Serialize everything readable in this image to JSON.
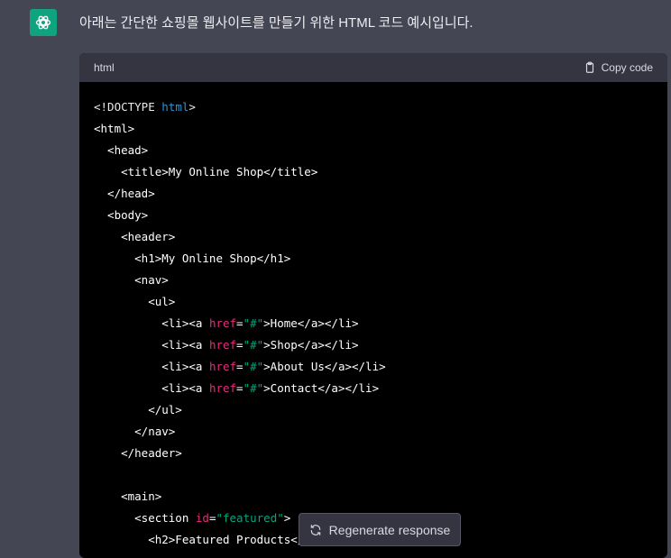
{
  "message": {
    "text": "아래는 간단한 쇼핑몰 웹사이트를 만들기 위한 HTML 코드 예시입니다."
  },
  "code": {
    "language": "html",
    "copy_label": "Copy code",
    "lines": [
      [
        [
          "doctype",
          "<!DOCTYPE "
        ],
        [
          "keyword",
          "html"
        ],
        [
          "doctype",
          ">"
        ]
      ],
      [
        [
          "tag",
          "<html>"
        ]
      ],
      [
        [
          "tag",
          "  <head>"
        ]
      ],
      [
        [
          "tag",
          "    <title>My Online Shop</title>"
        ]
      ],
      [
        [
          "tag",
          "  </head>"
        ]
      ],
      [
        [
          "tag",
          "  <body>"
        ]
      ],
      [
        [
          "tag",
          "    <header>"
        ]
      ],
      [
        [
          "tag",
          "      <h1>My Online Shop</h1>"
        ]
      ],
      [
        [
          "tag",
          "      <nav>"
        ]
      ],
      [
        [
          "tag",
          "        <ul>"
        ]
      ],
      [
        [
          "tag",
          "          <li><a "
        ],
        [
          "attr",
          "href"
        ],
        [
          "tag",
          "="
        ],
        [
          "str",
          "\"#\""
        ],
        [
          "tag",
          ">Home</a></li>"
        ]
      ],
      [
        [
          "tag",
          "          <li><a "
        ],
        [
          "attr",
          "href"
        ],
        [
          "tag",
          "="
        ],
        [
          "str",
          "\"#\""
        ],
        [
          "tag",
          ">Shop</a></li>"
        ]
      ],
      [
        [
          "tag",
          "          <li><a "
        ],
        [
          "attr",
          "href"
        ],
        [
          "tag",
          "="
        ],
        [
          "str",
          "\"#\""
        ],
        [
          "tag",
          ">About Us</a></li>"
        ]
      ],
      [
        [
          "tag",
          "          <li><a "
        ],
        [
          "attr",
          "href"
        ],
        [
          "tag",
          "="
        ],
        [
          "str",
          "\"#\""
        ],
        [
          "tag",
          ">Contact</a></li>"
        ]
      ],
      [
        [
          "tag",
          "        </ul>"
        ]
      ],
      [
        [
          "tag",
          "      </nav>"
        ]
      ],
      [
        [
          "tag",
          "    </header>"
        ]
      ],
      [
        [
          "tag",
          ""
        ]
      ],
      [
        [
          "tag",
          "    <main>"
        ]
      ],
      [
        [
          "tag",
          "      <section "
        ],
        [
          "attr",
          "id"
        ],
        [
          "tag",
          "="
        ],
        [
          "str",
          "\"featured\""
        ],
        [
          "tag",
          ">"
        ]
      ],
      [
        [
          "tag",
          "        <h2>Featured Products</h2>"
        ]
      ]
    ]
  },
  "regenerate": {
    "label": "Regenerate response"
  },
  "colors": {
    "avatar": "#10a37f",
    "background": "#444654",
    "code_bg": "#000000"
  },
  "icons": {
    "avatar": "openai-logo-icon",
    "copy": "clipboard-icon",
    "regenerate": "refresh-icon"
  }
}
